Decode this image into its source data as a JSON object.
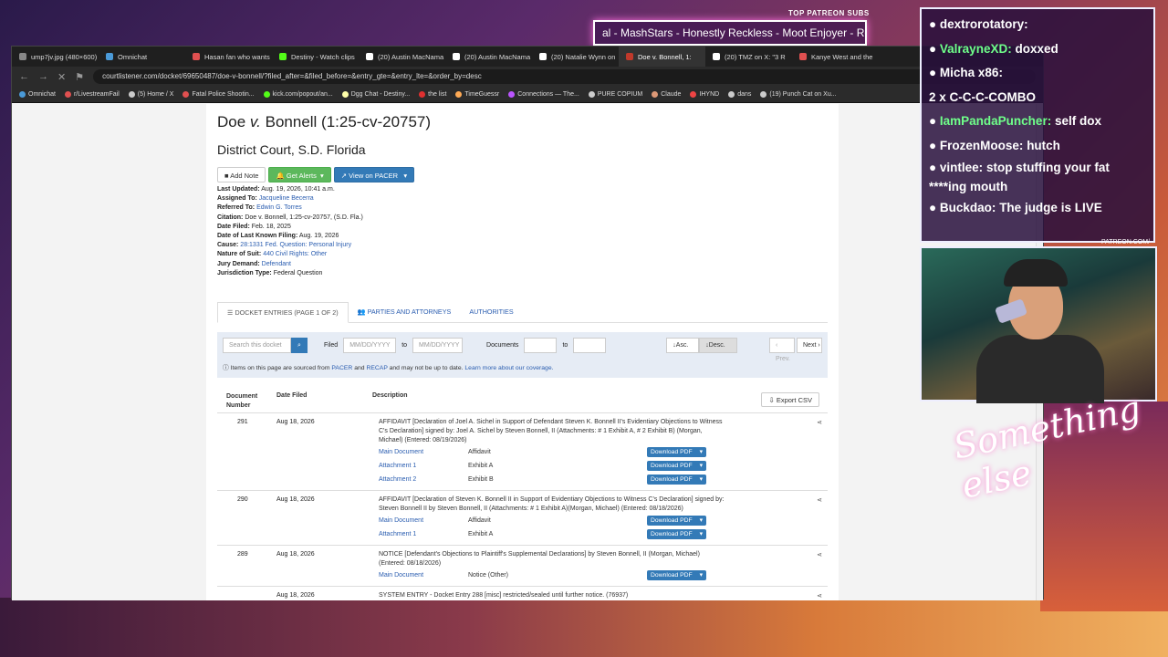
{
  "stream": {
    "top_subs_label": "TOP PATREON SUBS",
    "ticker_text": "al - MashStars - Honestly Reckless - Moot Enjoyer - Roach",
    "chat": [
      {
        "user": "dextrorotatory:",
        "message": "",
        "color": "u"
      },
      {
        "user": "ValrayneXD:",
        "message": "doxxed",
        "color": "g"
      },
      {
        "user": "Micha x86:",
        "message": "",
        "color": "u"
      },
      {
        "user": "",
        "message": "2 x C-C-C-COMBO",
        "color": "u"
      },
      {
        "user": "IamPandaPuncher:",
        "message": "self dox",
        "color": "g"
      },
      {
        "user": "FrozenMoose:",
        "message": "hutch",
        "color": "u"
      },
      {
        "user": "vintlee:",
        "message": "stop stuffing your fat ****ing mouth",
        "color": "u"
      },
      {
        "user": "Buckdao:",
        "message": "The judge is LIVE",
        "color": "u"
      }
    ],
    "webcam_label": "PATREON.COM/",
    "signature_text": "Something else"
  },
  "browser": {
    "tabs": [
      {
        "title": "ump7jv.jpg (480×600)",
        "color": "#888"
      },
      {
        "title": "Omnichat",
        "color": "#4a9ad8"
      },
      {
        "title": "Hasan fan who wants",
        "color": "#e05050"
      },
      {
        "title": "Destiny - Watch clips",
        "color": "#53fc18"
      },
      {
        "title": "(20) Austin MacNama",
        "color": "#fff"
      },
      {
        "title": "(20) Austin MacNama",
        "color": "#fff"
      },
      {
        "title": "(20) Natalie Wynn on",
        "color": "#fff"
      },
      {
        "title": "Doe v. Bonnell, 1:",
        "color": "#c0392b"
      },
      {
        "title": "(20) TMZ on X: \"3 R",
        "color": "#fff"
      },
      {
        "title": "Kanye West and the",
        "color": "#e05050"
      }
    ],
    "url": "courtlistener.com/docket/69650487/doe-v-bonnell/?filed_after=&filed_before=&entry_gte=&entry_lte=&order_by=desc",
    "bookmarks": [
      "Omnichat",
      "r/LivestreamFail",
      "(5) Home / X",
      "Fatal Police Shootin...",
      "kick.com/popout/an...",
      "Dgg Chat - Destiny...",
      "the list",
      "TimeGuessr",
      "Connections — The...",
      "PURE COPIUM",
      "Claude",
      "IHYND",
      "dans",
      "(19) Punch Cat on Xu..."
    ]
  },
  "case": {
    "title_pre": "Doe ",
    "title_v": "v.",
    "title_post": " Bonnell (1:25-cv-20757)",
    "court": "District Court, S.D. Florida",
    "buttons": {
      "add_note": "Add Note",
      "get_alerts": "Get Alerts",
      "view_pacer": "View on PACER"
    },
    "meta": [
      {
        "label": "Last Updated:",
        "value": "Aug. 19, 2026, 10:41 a.m.",
        "link": false
      },
      {
        "label": "Assigned To:",
        "value": "Jacqueline Becerra",
        "link": true
      },
      {
        "label": "Referred To:",
        "value": "Edwin G. Torres",
        "link": true
      },
      {
        "label": "Citation:",
        "value": "Doe v. Bonnell, 1:25-cv-20757, (S.D. Fla.)",
        "link": false
      },
      {
        "label": "Date Filed:",
        "value": "Feb. 18, 2025",
        "link": false
      },
      {
        "label": "Date of Last Known Filing:",
        "value": "Aug. 19, 2026",
        "link": false
      },
      {
        "label": "Cause:",
        "value": "28:1331 Fed. Question: Personal Injury",
        "link": true
      },
      {
        "label": "Nature of Suit:",
        "value": "440 Civil Rights: Other",
        "link": true
      },
      {
        "label": "Jury Demand:",
        "value": "Defendant",
        "link": true
      },
      {
        "label": "Jurisdiction Type:",
        "value": "Federal Question",
        "link": false
      }
    ],
    "tabs": [
      "DOCKET ENTRIES (PAGE 1 OF 2)",
      "PARTIES AND ATTORNEYS",
      "AUTHORITIES"
    ],
    "filter": {
      "search_placeholder": "Search this docket",
      "filed_label": "Filed",
      "date_placeholder": "MM/DD/YYYY",
      "to_label": "to",
      "documents_label": "Documents",
      "asc": "Asc.",
      "desc": "Desc.",
      "prev": "‹ Prev.",
      "next": "Next ›",
      "note_pre": "Items on this page are sourced from ",
      "note_pacer": "PACER",
      "note_and": " and ",
      "note_recap": "RECAP",
      "note_mid": " and may not be up to date. ",
      "note_link": "Learn more about our coverage."
    },
    "table_headers": {
      "doc_number": "Document Number",
      "date_filed": "Date Filed",
      "description": "Description",
      "export": "Export CSV"
    },
    "entries": [
      {
        "number": "291",
        "date": "Aug 18, 2026",
        "description": "AFFIDAVIT [Declaration of Joel A. Sichel in Support of Defendant Steven K. Bonnell II's Evidentiary Objections to Witness C's Declaration] signed by: Joel A. Sichel by Steven Bonnell, II (Attachments: # 1 Exhibit A, # 2 Exhibit B) (Morgan, Michael) (Entered: 08/19/2026)",
        "attachments": [
          {
            "name": "Main Document",
            "desc": "Affidavit",
            "btn": "Download PDF"
          },
          {
            "name": "Attachment 1",
            "desc": "Exhibit A",
            "btn": "Download PDF"
          },
          {
            "name": "Attachment 2",
            "desc": "Exhibit B",
            "btn": "Download PDF"
          }
        ]
      },
      {
        "number": "290",
        "date": "Aug 18, 2026",
        "description": "AFFIDAVIT [Declaration of Steven K. Bonnell II in Support of Evidentiary Objections to Witness C's Declaration] signed by: Steven Bonnell II by Steven Bonnell, II (Attachments: # 1 Exhibit A)(Morgan, Michael) (Entered: 08/18/2026)",
        "attachments": [
          {
            "name": "Main Document",
            "desc": "Affidavit",
            "btn": "Download PDF"
          },
          {
            "name": "Attachment 1",
            "desc": "Exhibit A",
            "btn": "Download PDF"
          }
        ]
      },
      {
        "number": "289",
        "date": "Aug 18, 2026",
        "description": "NOTICE [Defendant's Objections to Plaintiff's Supplemental Declarations] by Steven Bonnell, II (Morgan, Michael) (Entered: 08/18/2026)",
        "attachments": [
          {
            "name": "Main Document",
            "desc": "Notice (Other)",
            "btn": "Download PDF"
          }
        ]
      },
      {
        "number": "",
        "date": "Aug 18, 2026",
        "description": "SYSTEM ENTRY - Docket Entry 288 [misc] restricted/sealed until further notice. (76937)",
        "attachments": []
      }
    ]
  }
}
